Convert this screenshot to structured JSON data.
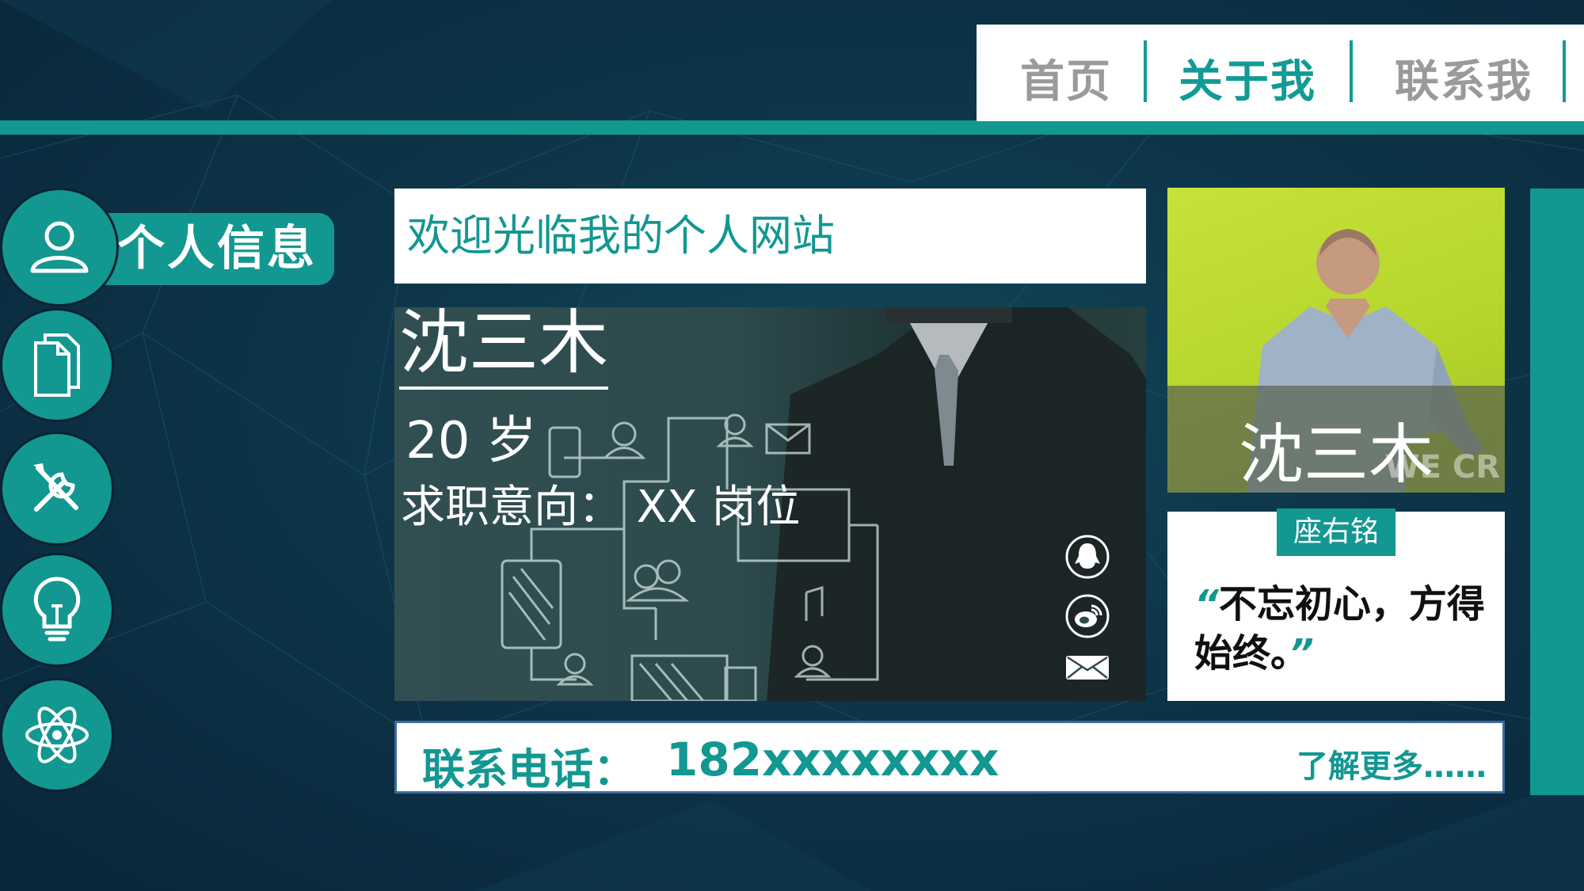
{
  "nav": {
    "items": [
      {
        "label": "首页",
        "color": "#9a9a9a"
      },
      {
        "label": "关于我",
        "color": "#129b94"
      },
      {
        "label": "联系我",
        "color": "#9a9a9a"
      }
    ]
  },
  "sidebar": {
    "active_label": "个人信息",
    "items": [
      {
        "icon": "user-icon"
      },
      {
        "icon": "document-icon"
      },
      {
        "icon": "tools-icon"
      },
      {
        "icon": "lightbulb-icon"
      },
      {
        "icon": "atom-icon"
      }
    ]
  },
  "welcome": {
    "text": "欢迎光临我的个人网站"
  },
  "profile": {
    "name": "沈三木",
    "age": "20 岁",
    "intent": "求职意向： XX 岗位",
    "social": [
      "qq-icon",
      "weibo-icon",
      "mail-icon"
    ]
  },
  "portrait": {
    "name": "沈三木",
    "watermark": "WE CR"
  },
  "motto": {
    "label": "座右铭",
    "open_quote": "“",
    "text": "不忘初心，方得始终。",
    "close_quote": "”"
  },
  "contact": {
    "label": "联系电话：",
    "phone": "182xxxxxxxx",
    "more": "了解更多……"
  },
  "colors": {
    "accent": "#139791",
    "background": "#0d3448"
  }
}
